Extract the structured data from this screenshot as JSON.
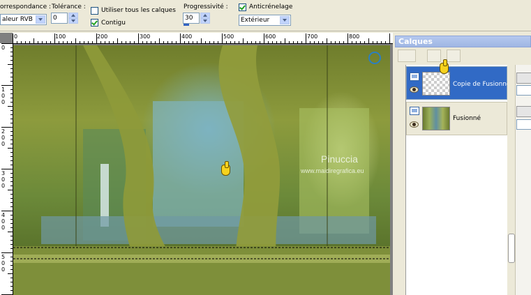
{
  "toolbar": {
    "correspondance_label": "orrespondance :",
    "correspondance_value": "aleur RVB",
    "tolerance_label": "Tolérance :",
    "tolerance_value": "0",
    "use_all_layers_label": "Utiliser tous les calques",
    "use_all_layers_checked": false,
    "contigu_label": "Contigu",
    "contigu_checked": true,
    "progressivite_label": "Progressivité :",
    "progressivite_value": "30",
    "anticrenelage_label": "Anticrénelage",
    "anticrenelage_checked": true,
    "anticrenelage_mode": "Extérieur"
  },
  "ruler": {
    "h_labels": [
      "0",
      "100",
      "200",
      "300",
      "400",
      "500",
      "600",
      "700",
      "800"
    ],
    "v_labels": [
      "0",
      "100",
      "200",
      "300",
      "400",
      "500"
    ]
  },
  "image": {
    "watermark_name": "Pinuccia",
    "watermark_url": "www.maidiregrafica.eu"
  },
  "layers_panel": {
    "title": "Calques",
    "layers": [
      {
        "name": "Copie de Fusionné",
        "selected": true
      },
      {
        "name": "Fusionné",
        "selected": false
      }
    ]
  },
  "icons": [
    "dropdown-arrow-icon",
    "spinner-icon",
    "checkbox-icon",
    "eye-icon",
    "layer-raster-icon",
    "new-layer-icon",
    "delete-layer-icon",
    "mask-icon",
    "hand-pointer-icon"
  ],
  "colors": {
    "selection_blue": "#316ac5",
    "panel_title": "#9fb6e3",
    "chrome": "#ece9d8"
  }
}
